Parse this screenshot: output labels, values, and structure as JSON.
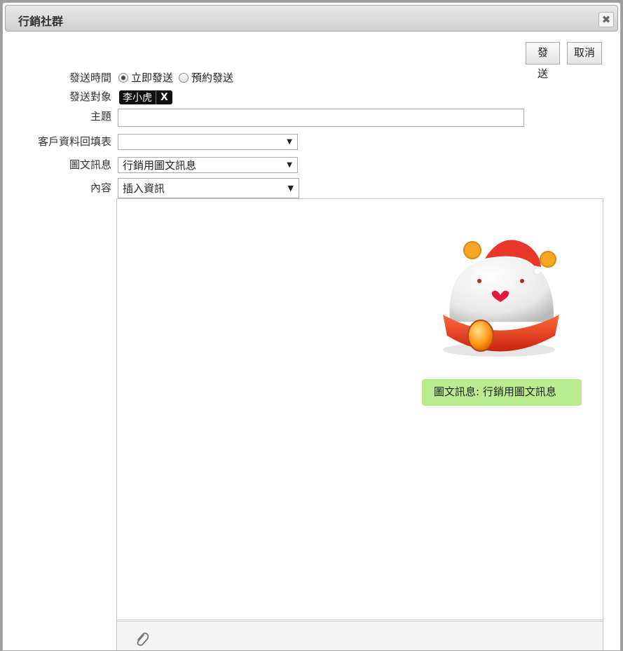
{
  "window": {
    "title": "行銷社群",
    "close_symbol": "✖"
  },
  "toolbar": {
    "send_label": "發送",
    "cancel_label": "取消"
  },
  "form": {
    "send_time": {
      "label": "發送時間",
      "options": [
        "立即發送",
        "預約發送"
      ],
      "selected": "立即發送"
    },
    "recipients": {
      "label": "發送對象",
      "tags": [
        {
          "name": "李小虎",
          "remove_symbol": "X"
        }
      ]
    },
    "subject": {
      "label": "主題",
      "value": ""
    },
    "customer_form": {
      "label": "客戶資料回填表",
      "value": ""
    },
    "rich_message": {
      "label": "圖文訊息",
      "value": "行銷用圖文訊息"
    },
    "content": {
      "label": "內容",
      "insert_select_value": "插入資訊"
    }
  },
  "editor": {
    "message_bubble": "圖文訊息: 行銷用圖文訊息",
    "image_icon": "mascot-icon",
    "attachment_icon": "paperclip-icon",
    "bubble_color": "#b8ec8e"
  }
}
